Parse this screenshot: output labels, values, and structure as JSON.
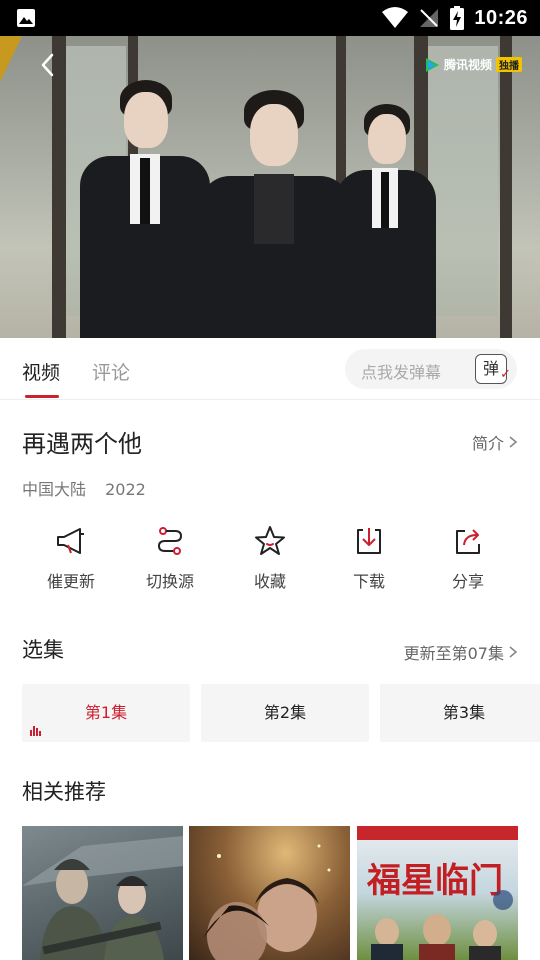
{
  "status_bar": {
    "time": "10:26"
  },
  "video": {
    "watermark": "腾讯视频",
    "watermark_tag": "独播"
  },
  "tabs": [
    {
      "label": "视频"
    },
    {
      "label": "评论"
    }
  ],
  "danmu": {
    "placeholder": "点我发弹幕",
    "button": "弹"
  },
  "show": {
    "title": "再遇两个他",
    "intro_link": "简介",
    "region": "中国大陆",
    "year": "2022"
  },
  "actions": [
    {
      "label": "催更新",
      "icon": "megaphone-icon"
    },
    {
      "label": "切换源",
      "icon": "switch-source-icon"
    },
    {
      "label": "收藏",
      "icon": "star-icon"
    },
    {
      "label": "下载",
      "icon": "download-icon"
    },
    {
      "label": "分享",
      "icon": "share-icon"
    }
  ],
  "episodes": {
    "title": "选集",
    "update_text": "更新至第07集",
    "items": [
      {
        "label": "第1集",
        "active": true
      },
      {
        "label": "第2集",
        "active": false
      },
      {
        "label": "第3集",
        "active": false
      }
    ]
  },
  "recommend": {
    "title": "相关推荐"
  },
  "colors": {
    "accent": "#cc1f2f",
    "status_bar": "#000000"
  }
}
